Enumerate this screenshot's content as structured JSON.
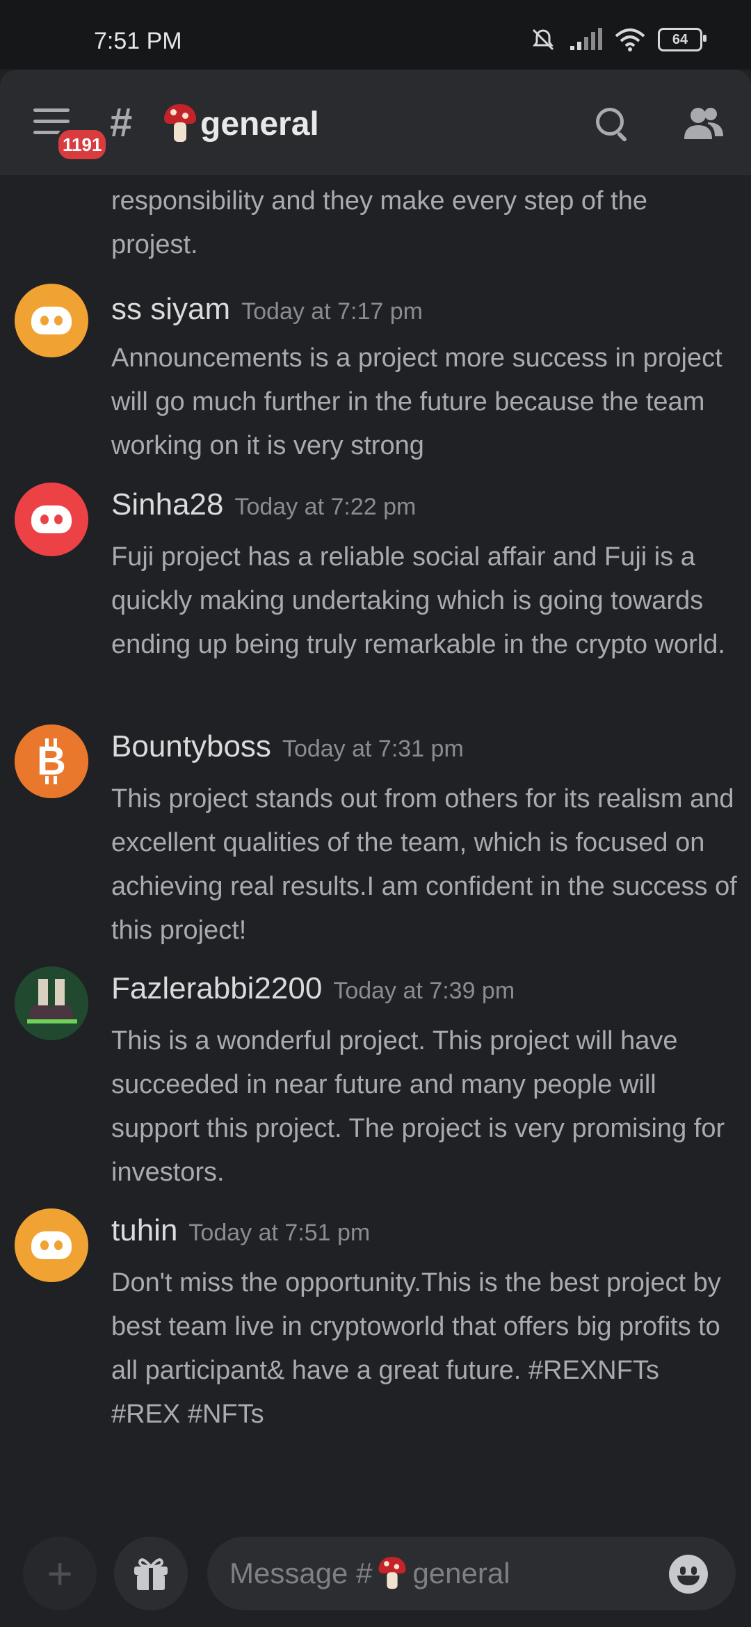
{
  "status_bar": {
    "time": "7:51 PM",
    "battery": "64"
  },
  "header": {
    "unread_badge": "1191",
    "channel_hash": "#",
    "channel_name": "general"
  },
  "continued_text": "responsibility and they make every step of the projest.",
  "messages": [
    {
      "username": "ss siyam",
      "timestamp": "Today at 7:17 pm",
      "avatar_color": "#f0a232",
      "text": "Announcements is a project more success in project will go much further in the future because the team working on it is very strong"
    },
    {
      "username": "Sinha28",
      "timestamp": "Today at 7:22 pm",
      "avatar_color": "#ed4245",
      "text": "Fuji project has a reliable social affair and Fuji is a quickly making undertaking which is going towards ending up being truly remarkable in the crypto world."
    },
    {
      "username": "Bountyboss",
      "timestamp": "Today at 7:31 pm",
      "avatar_color": "#e46a25",
      "text": "This project stands out from others for its realism and excellent qualities of the team, which is focused on achieving real results.I am confident in the success of this project!"
    },
    {
      "username": "Fazlerabbi2200",
      "timestamp": "Today at 7:39 pm",
      "avatar_color": "#1f4d31",
      "text": "This is a wonderful project. This project will have succeeded in near future and many people will support this project. The project is very promising for investors."
    },
    {
      "username": "tuhin",
      "timestamp": "Today at 7:51 pm",
      "avatar_color": "#f0a232",
      "text": "Don't miss the opportunity.This is the best project by best team live in cryptoworld that offers big profits to all participant& have a great future. #REXNFTs #REX #NFTs"
    }
  ],
  "composer": {
    "placeholder_prefix": "Message #",
    "placeholder_channel": "general"
  },
  "icons": {
    "menu": "hamburger-menu-icon",
    "search": "search-icon",
    "members": "members-icon",
    "plus": "plus-icon",
    "gift": "gift-icon",
    "emoji": "emoji-icon"
  }
}
